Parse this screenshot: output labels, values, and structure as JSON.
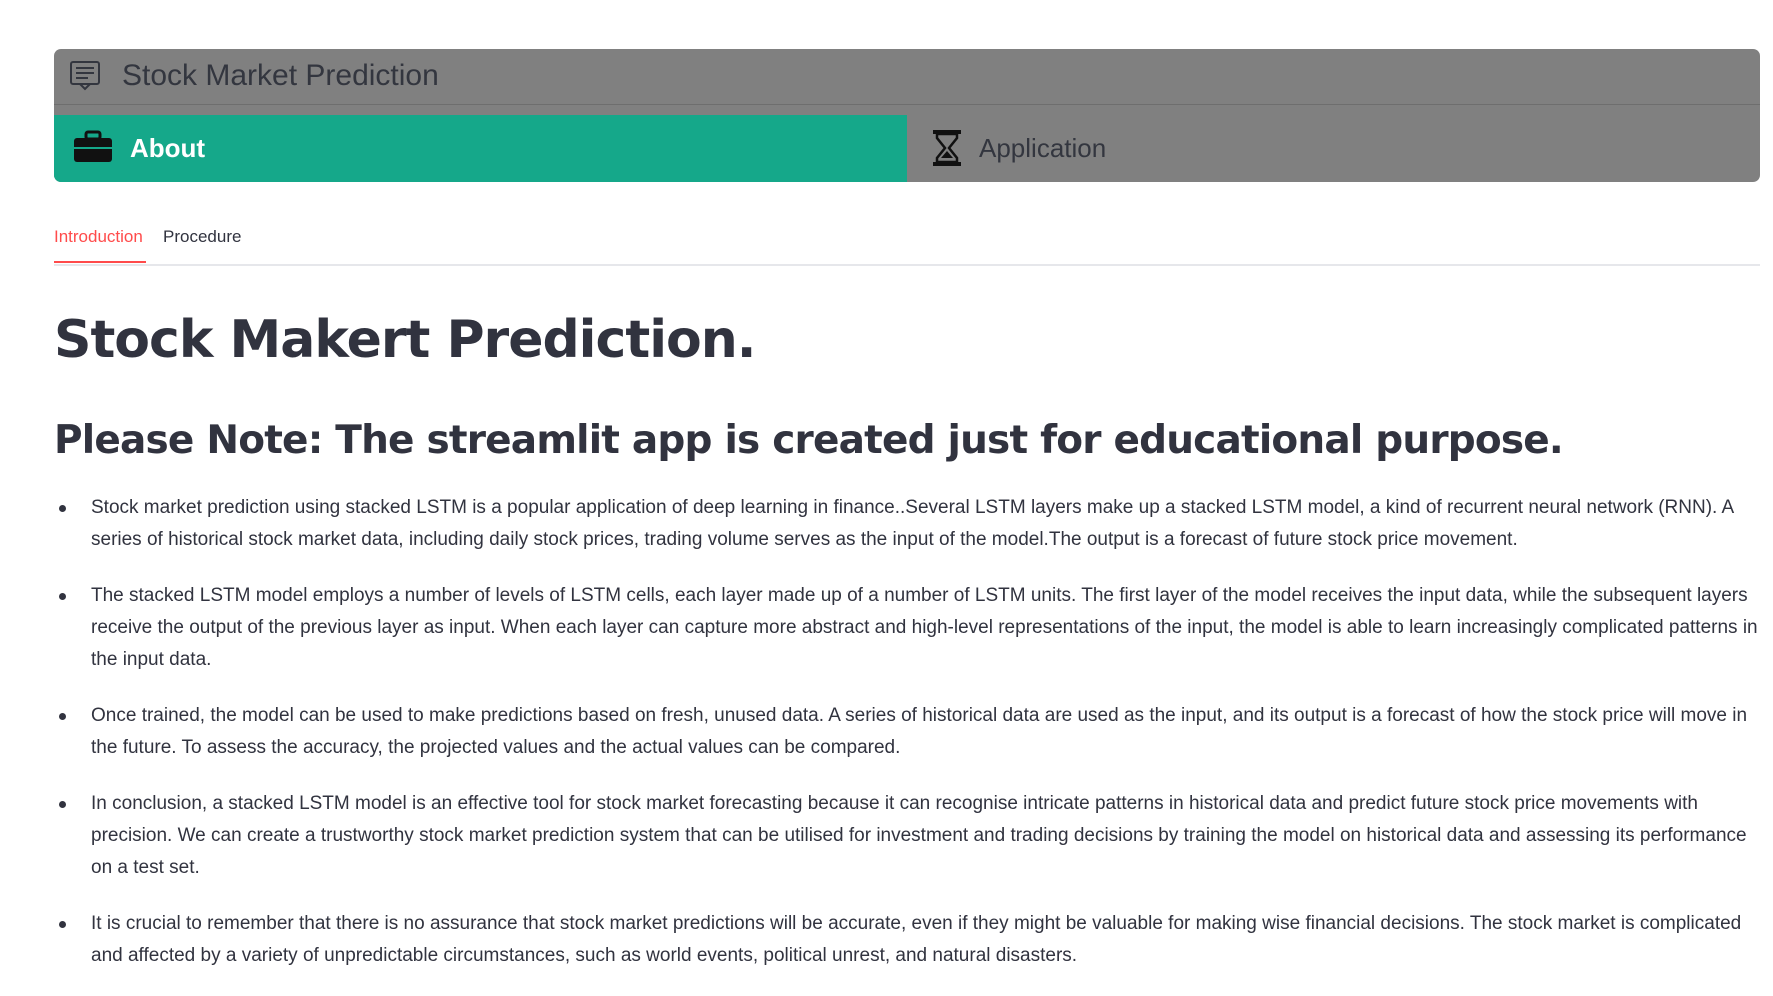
{
  "navbar": {
    "title": "Stock Market Prediction",
    "title_icon": "chat-square-text-icon",
    "items": [
      {
        "label": "About",
        "icon": "briefcase-icon",
        "active": true
      },
      {
        "label": "Application",
        "icon": "hourglass-icon",
        "active": false
      }
    ],
    "active_color": "#15a88a",
    "background_color": "#808080"
  },
  "tabs": [
    {
      "label": "Introduction",
      "active": true
    },
    {
      "label": "Procedure",
      "active": false
    }
  ],
  "main": {
    "title": "Stock Makert Prediction.",
    "note": "Please Note: The streamlit app is created just for educational purpose.",
    "bullets": [
      "Stock market prediction using stacked LSTM is a popular application of deep learning in finance..Several LSTM layers make up a stacked LSTM model, a kind of recurrent neural network (RNN). A series of historical stock market data, including daily stock prices, trading volume serves as the input of the model.The output is a forecast of future stock price movement.",
      "The stacked LSTM model employs a number of levels of LSTM cells, each layer made up of a number of LSTM units. The first layer of the model receives the input data, while the subsequent layers receive the output of the previous layer as input. When each layer can capture more abstract and high-level representations of the input, the model is able to learn increasingly complicated patterns in the input data.",
      "Once trained, the model can be used to make predictions based on fresh, unused data. A series of historical data are used as the input, and its output is a forecast of how the stock price will move in the future. To assess the accuracy, the projected values and the actual values can be compared.",
      "In conclusion, a stacked LSTM model is an effective tool for stock market forecasting because it can recognise intricate patterns in historical data and predict future stock price movements with precision. We can create a trustworthy stock market prediction system that can be utilised for investment and trading decisions by training the model on historical data and assessing its performance on a test set.",
      "It is crucial to remember that there is no assurance that stock market predictions will be accurate, even if they might be valuable for making wise financial decisions. The stock market is complicated and affected by a variety of unpredictable circumstances, such as world events, political unrest, and natural disasters."
    ]
  },
  "colors": {
    "tab_active": "#ff4b4b",
    "text": "#31333f"
  }
}
